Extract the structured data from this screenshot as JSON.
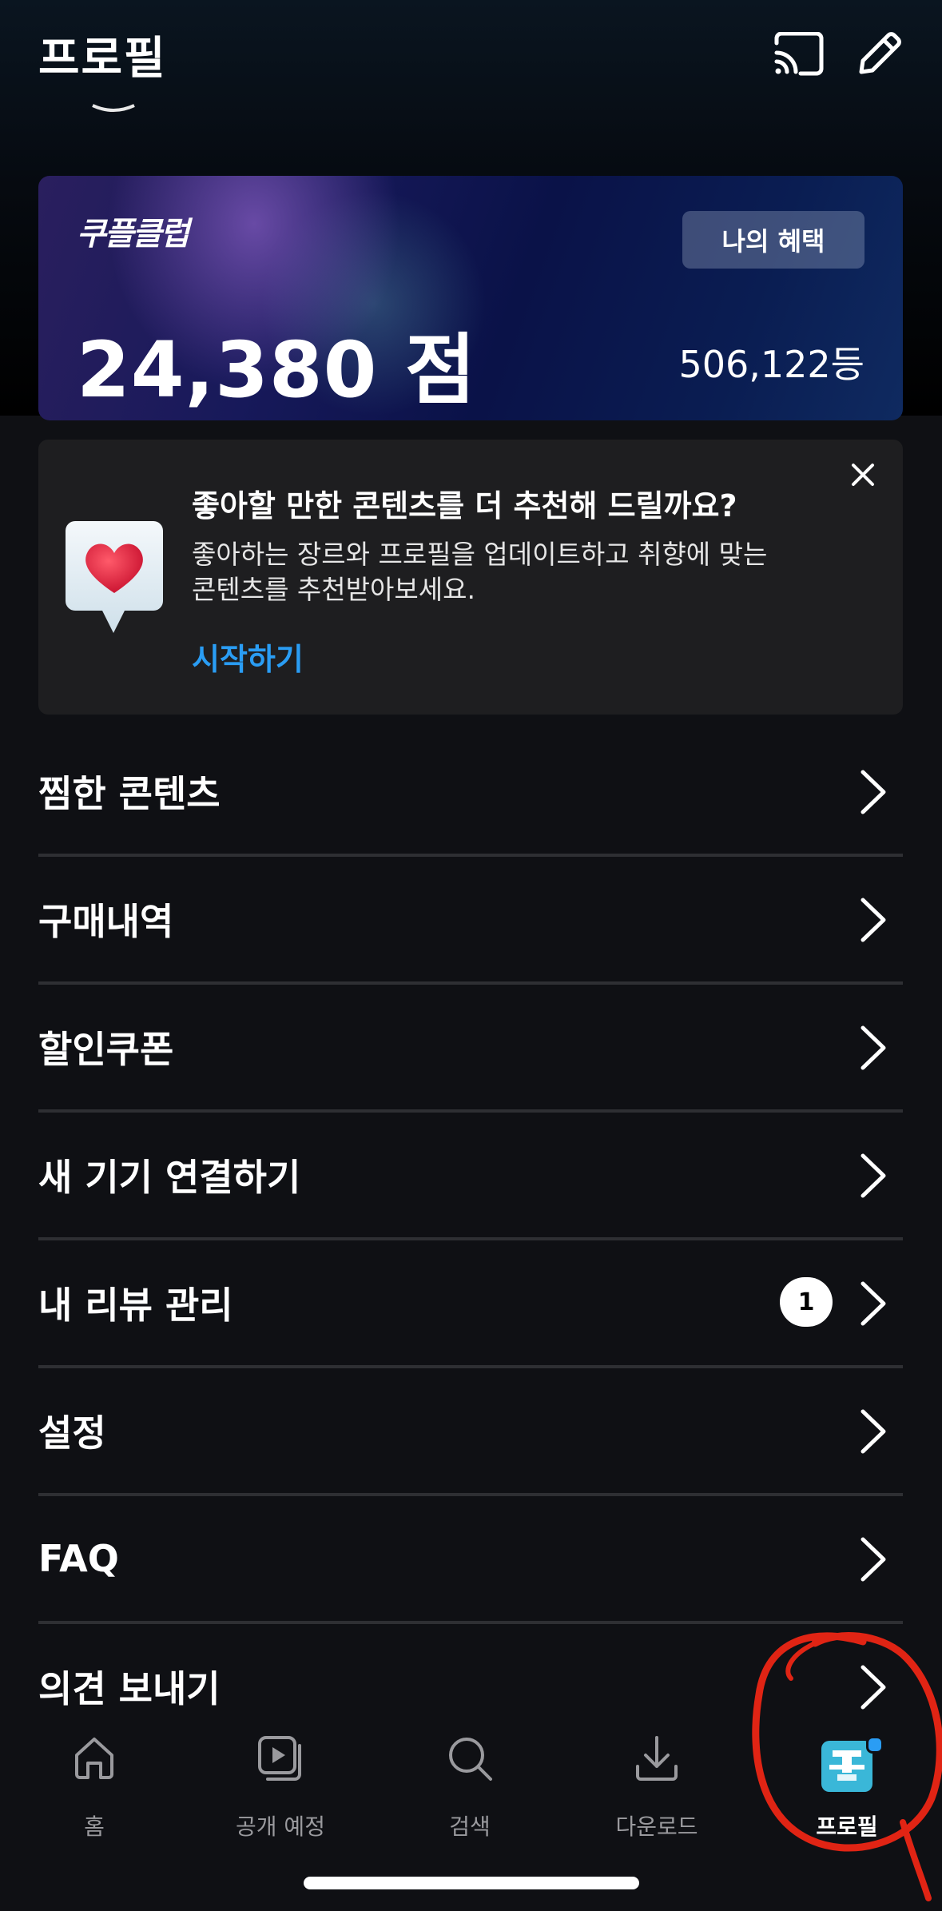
{
  "header": {
    "title": "프로필",
    "cast_icon": "cast-icon",
    "edit_icon": "pencil-icon"
  },
  "club_card": {
    "logo": "쿠플클럽",
    "benefit_button": "나의 혜택",
    "points": "24,380 점",
    "rank": "506,122등",
    "colors": {
      "bg_start": "#2a1f5e",
      "bg_end": "#0f2a60"
    }
  },
  "recommend": {
    "title": "좋아할 만한 콘텐츠를 더 추천해 드릴까요?",
    "description": "좋아하는 장르와 프로필을 업데이트하고 취향에 맞는 콘텐츠를 추천받아보세요.",
    "link": "시작하기",
    "icon": "heart-badge-icon",
    "close_icon": "close-icon",
    "link_color": "#2a9df4"
  },
  "menu": {
    "items": [
      {
        "label": "찜한 콘텐츠"
      },
      {
        "label": "구매내역"
      },
      {
        "label": "할인쿠폰"
      },
      {
        "label": "새 기기 연결하기"
      },
      {
        "label": "내 리뷰 관리",
        "badge": "1"
      },
      {
        "label": "설정"
      },
      {
        "label": "FAQ"
      },
      {
        "label": "의견 보내기"
      }
    ]
  },
  "tabbar": {
    "tabs": [
      {
        "label": "홈",
        "icon": "home-icon"
      },
      {
        "label": "공개 예정",
        "icon": "upcoming-play-icon"
      },
      {
        "label": "검색",
        "icon": "search-icon"
      },
      {
        "label": "다운로드",
        "icon": "download-icon"
      },
      {
        "label": "프로필",
        "icon": "profile-avatar",
        "active": true
      }
    ]
  }
}
